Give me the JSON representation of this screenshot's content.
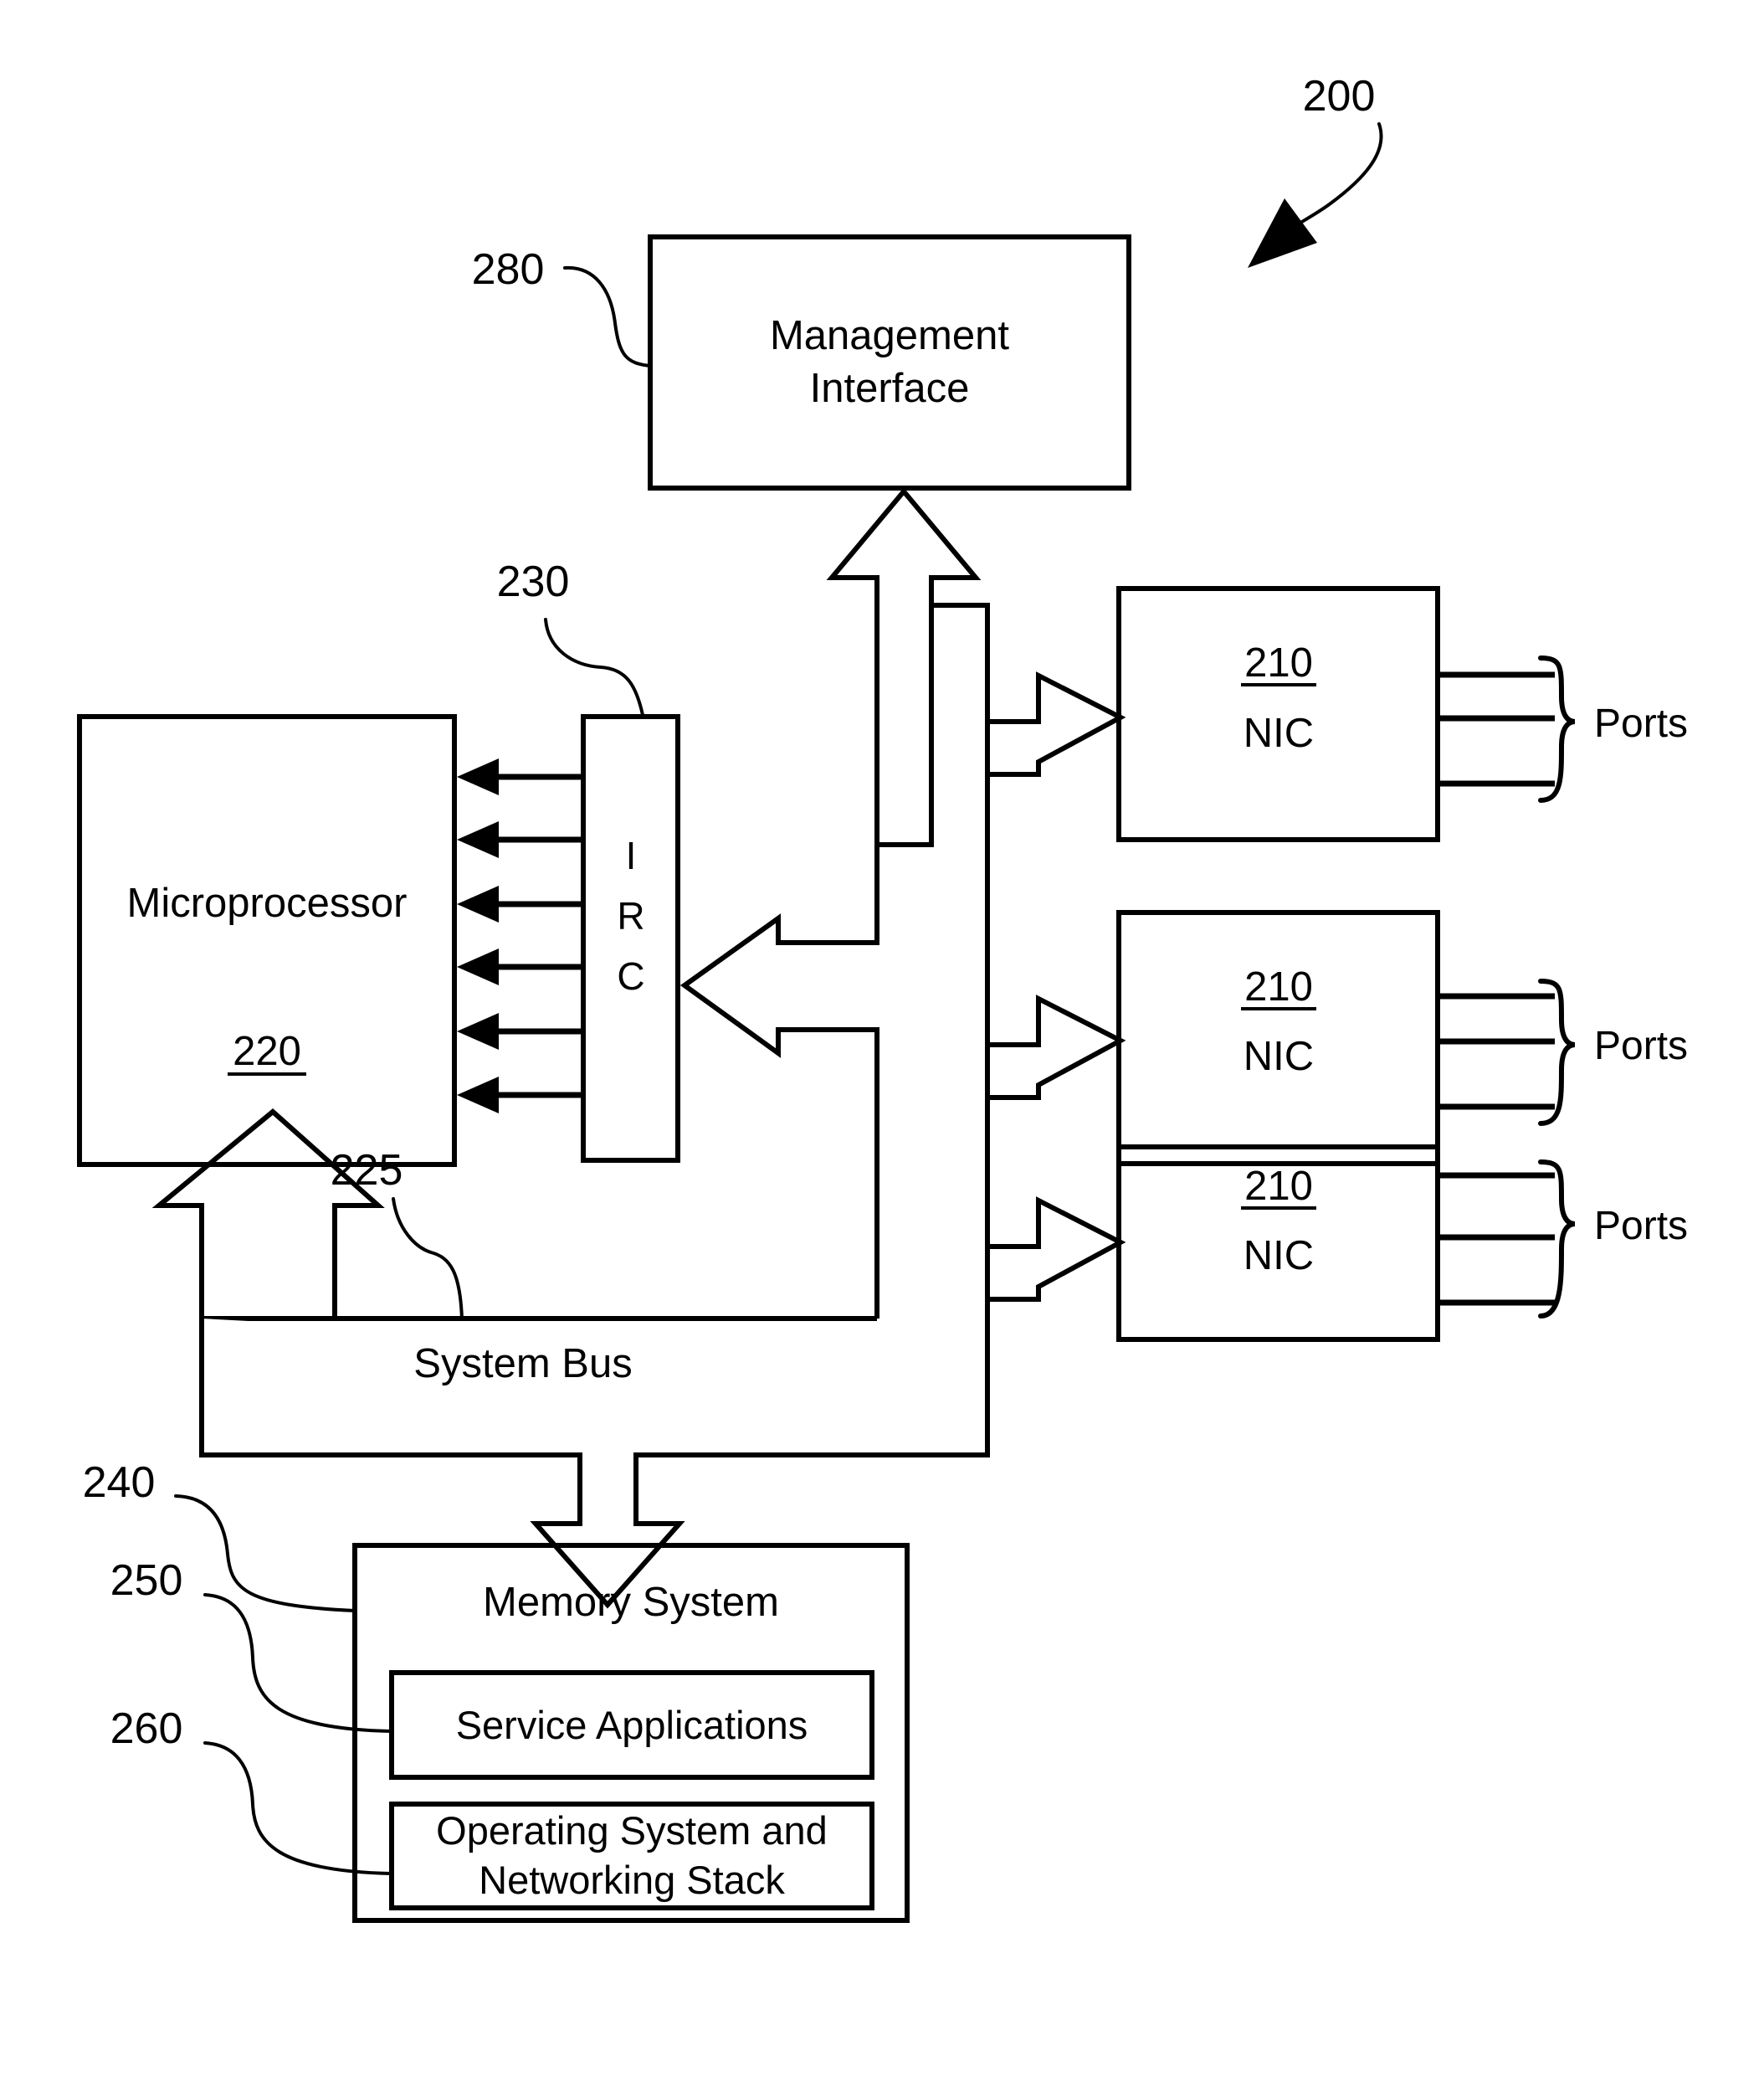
{
  "figure": {
    "number": "200",
    "title_text": "200"
  },
  "reference_labels": {
    "system": "200",
    "management_interface": "280",
    "irc": "230",
    "system_bus": "225",
    "microprocessor": "220",
    "nic": "210",
    "memory_system": "240",
    "service_applications": "250",
    "operating_system": "260"
  },
  "blocks": {
    "management_interface": {
      "label_line1": "Management",
      "label_line2": "Interface",
      "ref": "280"
    },
    "microprocessor": {
      "label": "Microprocessor",
      "ref": "220"
    },
    "irc": {
      "letters": [
        "I",
        "R",
        "C"
      ],
      "ref": "230",
      "full_label": "IRC"
    },
    "system_bus": {
      "label": "System Bus",
      "ref": "225"
    },
    "memory_system": {
      "label": "Memory System",
      "ref": "240",
      "children": [
        {
          "label": "Service Applications",
          "ref": "250"
        },
        {
          "label_line1": "Operating System and",
          "label_line2": "Networking Stack",
          "ref": "260"
        }
      ]
    },
    "nics": [
      {
        "ref": "210",
        "label": "NIC",
        "ports_label": "Ports",
        "port_count": 3
      },
      {
        "ref": "210",
        "label": "NIC",
        "ports_label": "Ports",
        "port_count": 3
      },
      {
        "ref": "210",
        "label": "NIC",
        "ports_label": "Ports",
        "port_count": 3
      }
    ]
  },
  "colors": {
    "stroke": "#000000",
    "background": "#ffffff",
    "fill": "#ffffff"
  },
  "interrupt_lines": {
    "count": 6,
    "direction": "irc-to-microprocessor"
  }
}
